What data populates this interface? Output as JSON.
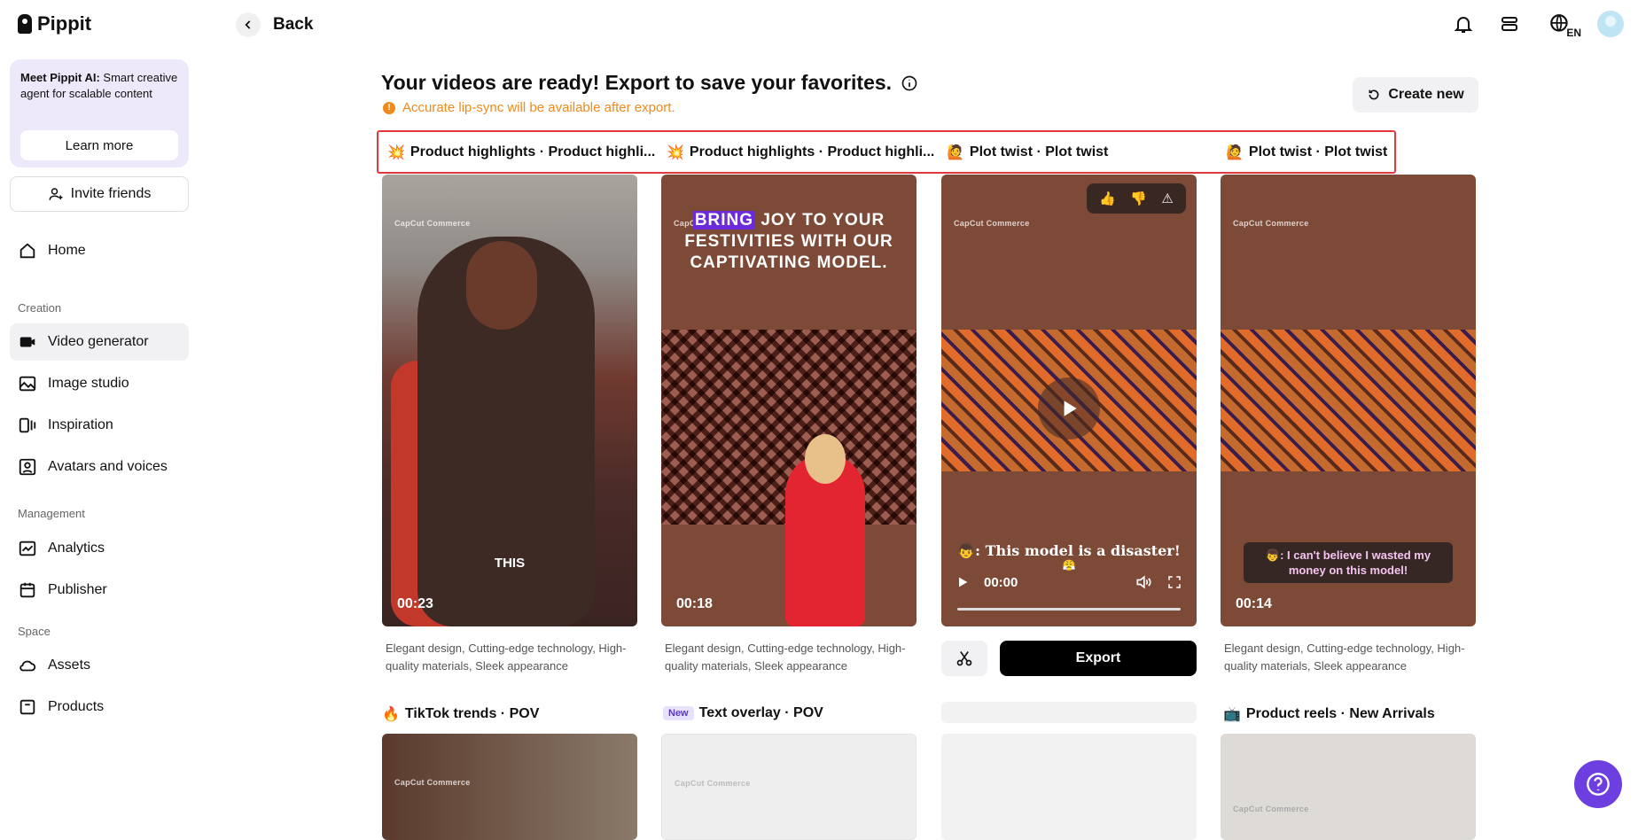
{
  "app": {
    "name": "Pippit"
  },
  "sidebar": {
    "promo": {
      "title_bold": "Meet Pippit AI:",
      "title_rest": " Smart creative agent for scalable content",
      "button": "Learn more"
    },
    "invite": "Invite friends",
    "home": "Home",
    "sections": {
      "creation": "Creation",
      "management": "Management",
      "space": "Space"
    },
    "items": {
      "video_generator": "Video generator",
      "image_studio": "Image studio",
      "inspiration": "Inspiration",
      "avatars": "Avatars and voices",
      "analytics": "Analytics",
      "publisher": "Publisher",
      "assets": "Assets",
      "products": "Products"
    }
  },
  "header": {
    "back": "Back",
    "lang": "EN"
  },
  "main": {
    "title": "Your videos are ready! Export to save your favorites.",
    "warning": "Accurate lip-sync will be available after export.",
    "create_new": "Create new",
    "tabs": [
      {
        "emoji": "💥",
        "label": "Product highlights · Product highli..."
      },
      {
        "emoji": "💥",
        "label": "Product highlights · Product highli..."
      },
      {
        "emoji": "🙋",
        "label": "Plot twist · Plot twist"
      },
      {
        "emoji": "🙋",
        "label": "Plot twist · Plot twist"
      }
    ],
    "cards": [
      {
        "duration": "00:23",
        "caption": "THIS",
        "desc": "Elegant design, Cutting-edge technology, High-quality materials, Sleek appearance"
      },
      {
        "duration": "00:18",
        "banner_hl": "BRING",
        "banner_rest1": " JOY TO YOUR",
        "banner_line2": "FESTIVITIES WITH OUR",
        "banner_line3": "CAPTIVATING MODEL.",
        "desc": "Elegant design, Cutting-edge technology, High-quality materials, Sleek appearance"
      },
      {
        "caption": "👦: This model is a disaster!",
        "caption_emoji": "😤",
        "time": "00:00"
      },
      {
        "duration": "00:14",
        "subtitle": "👦: I can't believe I wasted my money on this model!",
        "desc": "Elegant design, Cutting-edge technology, High-quality materials, Sleek appearance"
      }
    ],
    "watermark": "CapCut Commerce",
    "export": "Export",
    "row2_tabs": [
      {
        "emoji": "🔥",
        "label": "TikTok trends · POV"
      },
      {
        "badge": "New",
        "label": "Text overlay · POV"
      },
      {
        "emoji": "📺",
        "label": "Product reels · New Arrivals"
      }
    ]
  }
}
